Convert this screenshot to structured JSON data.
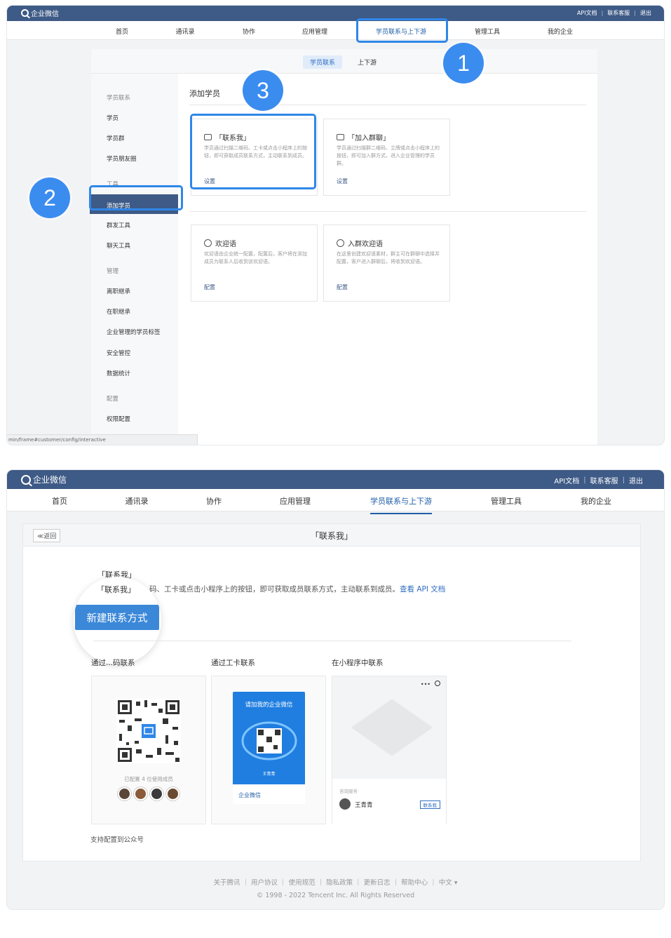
{
  "app": {
    "name": "企业微信"
  },
  "topbar": {
    "links": [
      "API文档",
      "联系客服",
      "退出"
    ]
  },
  "nav": {
    "items": [
      "首页",
      "通讯录",
      "协作",
      "应用管理",
      "学员联系与上下游",
      "管理工具",
      "我的企业"
    ],
    "active": "学员联系与上下游"
  },
  "steps": [
    "1",
    "2",
    "3"
  ],
  "shot1": {
    "subtabs": [
      "学员联系",
      "上下游"
    ],
    "sidebar": [
      {
        "label": "学员联系",
        "group": true
      },
      {
        "label": "学员"
      },
      {
        "label": "学员群"
      },
      {
        "label": "学员朋友圈"
      },
      {
        "label": "工具",
        "group": true
      },
      {
        "label": "添加学员",
        "active": true
      },
      {
        "label": "群发工具"
      },
      {
        "label": "聊天工具"
      },
      {
        "label": "管理",
        "group": true
      },
      {
        "label": "离职继承"
      },
      {
        "label": "在职继承"
      },
      {
        "label": "企业管理的学员标签"
      },
      {
        "label": "安全管控"
      },
      {
        "label": "数据统计"
      },
      {
        "label": "配置",
        "group": true
      },
      {
        "label": "权限配置"
      }
    ],
    "content_title": "添加学员",
    "cards": [
      {
        "title": "「联系我」",
        "desc": "学员通过扫描二维码、工卡或点击小程序上的按钮，即可获取成员联系方式，主动联系到成员。",
        "action": "设置"
      },
      {
        "title": "「加入群聊」",
        "desc": "学员通过扫描群二维码、立牌或点击小程序上的按钮，即可加入群方式，进入企业管理的学员群。",
        "action": "设置"
      },
      {
        "title": "欢迎语",
        "desc": "欢迎语由企业统一配置，配置后，客户将在添加成员为联系人后收到该欢迎语。",
        "action": "配置"
      },
      {
        "title": "入群欢迎语",
        "desc": "在这里创建欢迎语素材，群主可在群聊中选择并配置，客户进入群聊后，将收到欢迎语。",
        "action": "配置"
      }
    ],
    "status_url": "min/frame#customer/config/interactive"
  },
  "shot2": {
    "back": "≪返回",
    "title": "「联系我」",
    "intro_title": "「联系我」",
    "intro_desc_a": "码、工卡或点击小程序上的按钮，即可获取成员联系方式，主动联系到成员。",
    "intro_link": "查看 API 文档",
    "new_button": "新建联系方式",
    "cols": [
      "通过...码联系",
      "通过工卡联系",
      "在小程序中联系"
    ],
    "qr_caption": "已配置 4 位使用成员",
    "badge_title": "请加我的企业微信",
    "badge_name": "王青青",
    "badge_logo": "企业微信",
    "mp_label": "咨询服务",
    "mp_name": "王青青",
    "mp_btn": "联系我",
    "support": "支持配置到公众号"
  },
  "footer": {
    "links": "关于腾讯 ｜ 用户协议 ｜ 使用规范 ｜ 隐私政策 ｜ 更新日志 ｜ 帮助中心 ｜ 中文 ▾",
    "copyright": "© 1998 - 2022 Tencent Inc. All Rights Reserved"
  },
  "colors": {
    "topbar": "#3e5a86",
    "accent": "#2f87e8",
    "link": "#2f6ec2"
  }
}
